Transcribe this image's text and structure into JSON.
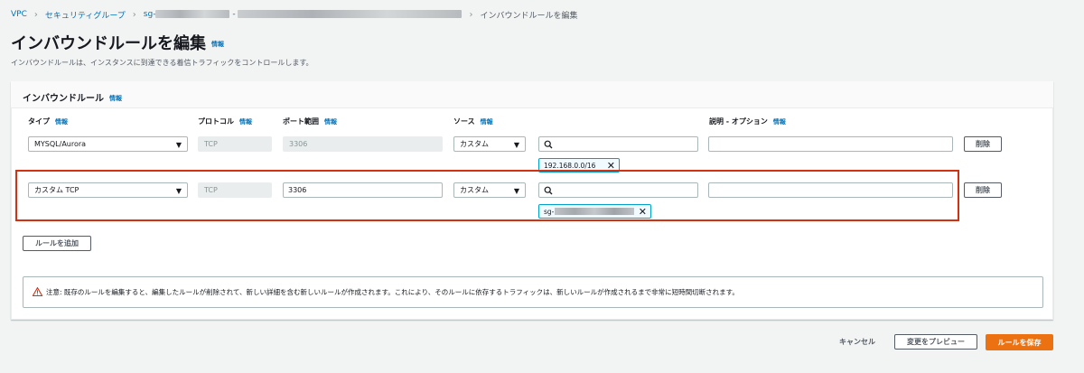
{
  "breadcrumb": {
    "items": [
      "VPC",
      "セキュリティグループ",
      "sg-",
      "-"
    ],
    "current": "インバウンドルールを編集"
  },
  "page": {
    "title": "インバウンドルールを編集",
    "info": "情報",
    "description": "インバウンドルールは、インスタンスに到達できる着信トラフィックをコントロールします。"
  },
  "panel": {
    "title": "インバウンドルール",
    "info": "情報",
    "columns": {
      "type": "タイプ",
      "protocol": "プロトコル",
      "port_range": "ポート範囲",
      "source": "ソース",
      "description": "説明 - オプション",
      "info": "情報"
    },
    "rules": [
      {
        "type": "MYSQL/Aurora",
        "protocol": "TCP",
        "port": "3306",
        "source": "カスタム",
        "search_value": "",
        "token": "192.168.0.0/16",
        "description": "",
        "delete_label": "削除"
      },
      {
        "type": "カスタム TCP",
        "protocol": "TCP",
        "port": "3306",
        "source": "カスタム",
        "search_value": "",
        "token": "sg-",
        "description": "",
        "delete_label": "削除"
      }
    ],
    "add_rule_label": "ルールを追加",
    "warning": "注意: 既存のルールを編集すると、編集したルールが削除されて、新しい詳細を含む新しいルールが作成されます。これにより、そのルールに依存するトラフィックは、新しいルールが作成されるまで非常に短時間切断されます。"
  },
  "footer": {
    "cancel_label": "キャンセル",
    "preview_label": "変更をプレビュー",
    "save_label": "ルールを保存"
  },
  "colors": {
    "link": "#0073bb",
    "primary": "#ec7211",
    "highlight": "#d13212",
    "token_border": "#00a1c9"
  }
}
